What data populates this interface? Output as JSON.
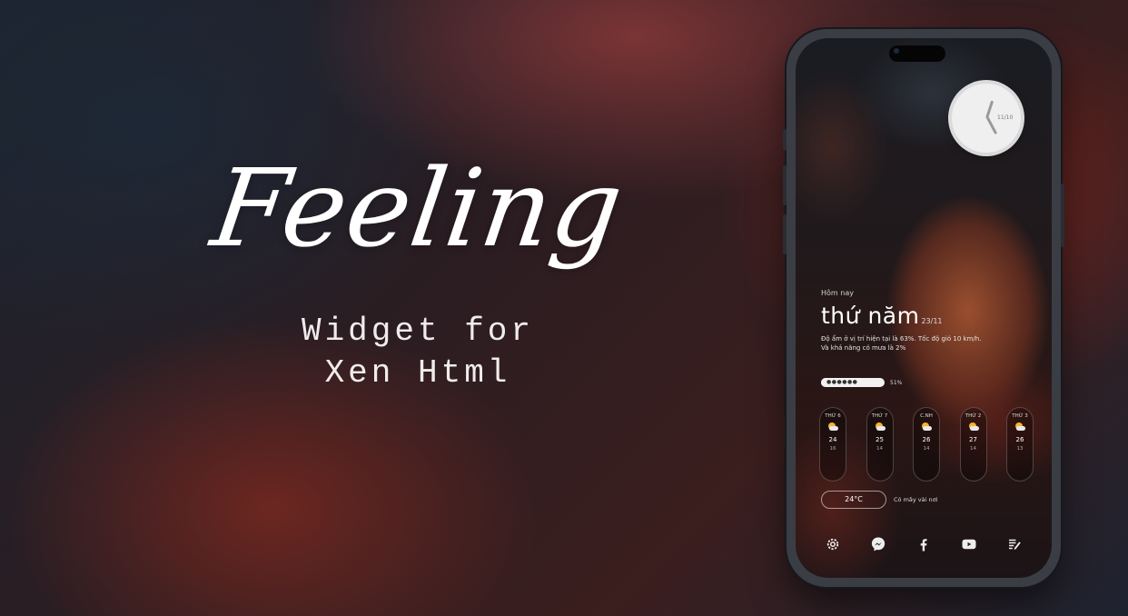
{
  "hero": {
    "title": "Feeling",
    "subtitle_line1": "Widget for",
    "subtitle_line2": "Xen Html"
  },
  "clock": {
    "date": "11/10"
  },
  "weather": {
    "today_label": "Hôm nay",
    "day_name": "thứ năm",
    "date": "23/11",
    "description_line1": "Độ ẩm ở vị trí hiện tại là 63%. Tốc độ gió 10 km/h.",
    "description_line2": "Và khả năng có mưa là 2%",
    "battery_percent": "51%",
    "battery_fraction": 0.51,
    "current_temp": "24°C",
    "condition": "Có mây vài nơi",
    "forecast": [
      {
        "day": "THỨ 6",
        "high": "24",
        "low": "16",
        "icon": "partly-cloudy-icon"
      },
      {
        "day": "THỨ 7",
        "high": "25",
        "low": "14",
        "icon": "partly-cloudy-icon"
      },
      {
        "day": "C.NH",
        "high": "26",
        "low": "14",
        "icon": "partly-cloudy-icon"
      },
      {
        "day": "THỨ 2",
        "high": "27",
        "low": "14",
        "icon": "partly-cloudy-icon"
      },
      {
        "day": "THỨ 3",
        "high": "26",
        "low": "13",
        "icon": "partly-cloudy-icon"
      }
    ]
  },
  "dock": {
    "icons": [
      "settings-icon",
      "messenger-icon",
      "facebook-icon",
      "youtube-icon",
      "notes-icon"
    ]
  },
  "colors": {
    "accent_sun": "#f3b431",
    "text_primary": "#ffffff"
  }
}
